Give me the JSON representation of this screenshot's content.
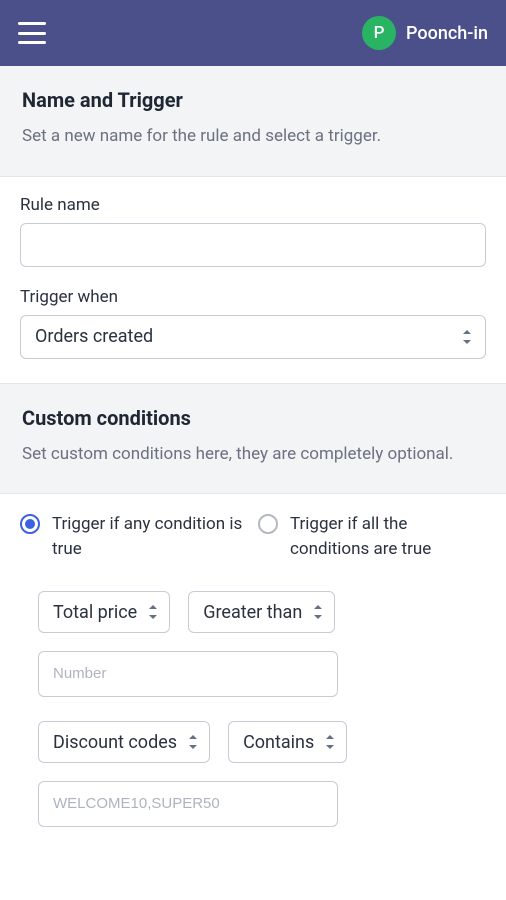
{
  "header": {
    "avatar_letter": "P",
    "username": "Poonch-in"
  },
  "section1": {
    "title": "Name and Trigger",
    "subtitle": "Set a new name for the rule and select a trigger."
  },
  "rule_name": {
    "label": "Rule name",
    "value": ""
  },
  "trigger_when": {
    "label": "Trigger when",
    "selected": "Orders created"
  },
  "section2": {
    "title": "Custom conditions",
    "subtitle": "Set custom conditions here, they are completely optional."
  },
  "radios": {
    "any": "Trigger if any condition is true",
    "all": "Trigger if all the conditions are true",
    "selected": "any"
  },
  "condition1": {
    "field": "Total price",
    "operator": "Greater than",
    "placeholder": "Number",
    "value": ""
  },
  "condition2": {
    "field": "Discount codes",
    "operator": "Contains",
    "placeholder": "WELCOME10,SUPER50",
    "value": ""
  }
}
